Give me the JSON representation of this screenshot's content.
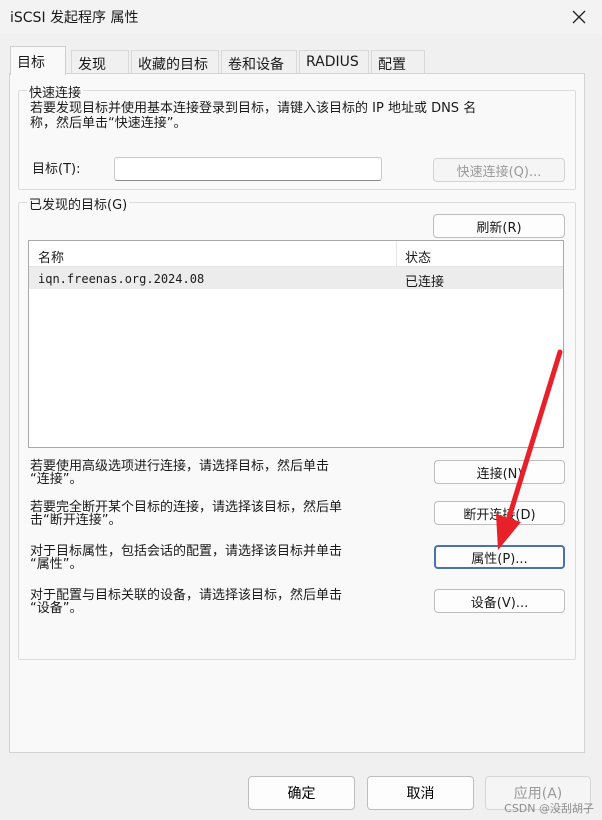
{
  "window": {
    "title": "iSCSI 发起程序 属性"
  },
  "tabs": [
    {
      "label": "目标",
      "active": true
    },
    {
      "label": "发现"
    },
    {
      "label": "收藏的目标"
    },
    {
      "label": "卷和设备"
    },
    {
      "label": "RADIUS"
    },
    {
      "label": "配置"
    }
  ],
  "quick_connect": {
    "legend": "快速连接",
    "desc_line1": "若要发现目标并使用基本连接登录到目标，请键入该目标的 IP 地址或 DNS 名",
    "desc_line2": "称，然后单击“快速连接”。",
    "target_label": "目标(T):",
    "target_value": "",
    "button": "快速连接(Q)..."
  },
  "discovered": {
    "legend": "已发现的目标(G)",
    "refresh_button": "刷新(R)",
    "columns": [
      "名称",
      "状态"
    ],
    "rows": [
      {
        "name": "iqn.freenas.org.2024.08",
        "status": "已连接"
      }
    ],
    "actions": [
      {
        "desc_line1": "若要使用高级选项进行连接，请选择目标，然后单击",
        "desc_line2": "“连接”。",
        "button": "连接(N)"
      },
      {
        "desc_line1": "若要完全断开某个目标的连接，请选择该目标，然后单",
        "desc_line2": "击“断开连接”。",
        "button": "断开连接(D)"
      },
      {
        "desc_line1": "对于目标属性，包括会话的配置，请选择该目标并单击",
        "desc_line2": "“属性”。",
        "button": "属性(P)..."
      },
      {
        "desc_line1": "对于配置与目标关联的设备，请选择该目标，然后单击",
        "desc_line2": "“设备”。",
        "button": "设备(V)..."
      }
    ]
  },
  "footer": {
    "ok": "确定",
    "cancel": "取消",
    "apply": "应用(A)"
  },
  "watermark": "CSDN @没刮胡子",
  "colors": {
    "arrow": "#e8202a",
    "primary_border": "#4a74a9"
  }
}
